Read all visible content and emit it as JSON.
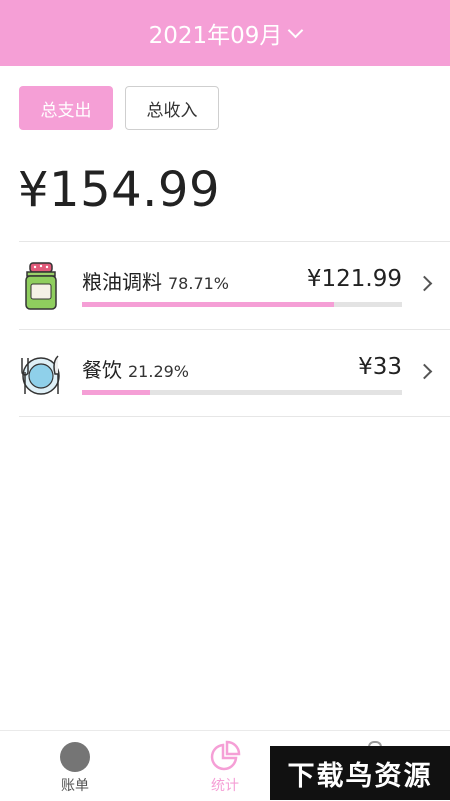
{
  "header": {
    "month_label": "2021年09月"
  },
  "toggle": {
    "expense_label": "总支出",
    "income_label": "总收入"
  },
  "summary": {
    "total": "¥154.99"
  },
  "categories": [
    {
      "name": "粮油调料",
      "percent": "78.71%",
      "amount": "¥121.99",
      "fraction": 0.7871,
      "icon": "condiment-jar-icon"
    },
    {
      "name": "餐饮",
      "percent": "21.29%",
      "amount": "¥33",
      "fraction": 0.2129,
      "icon": "dining-plate-icon"
    }
  ],
  "tabbar": {
    "items": [
      {
        "label": "账单",
        "icon": "bill-icon"
      },
      {
        "label": "统计",
        "icon": "pie-chart-icon",
        "active": true
      },
      {
        "label": "",
        "icon": "settings-icon"
      }
    ]
  },
  "watermark": {
    "text": "下载鸟资源"
  },
  "colors": {
    "accent": "#f59fd6",
    "track": "#e3e3e3"
  }
}
